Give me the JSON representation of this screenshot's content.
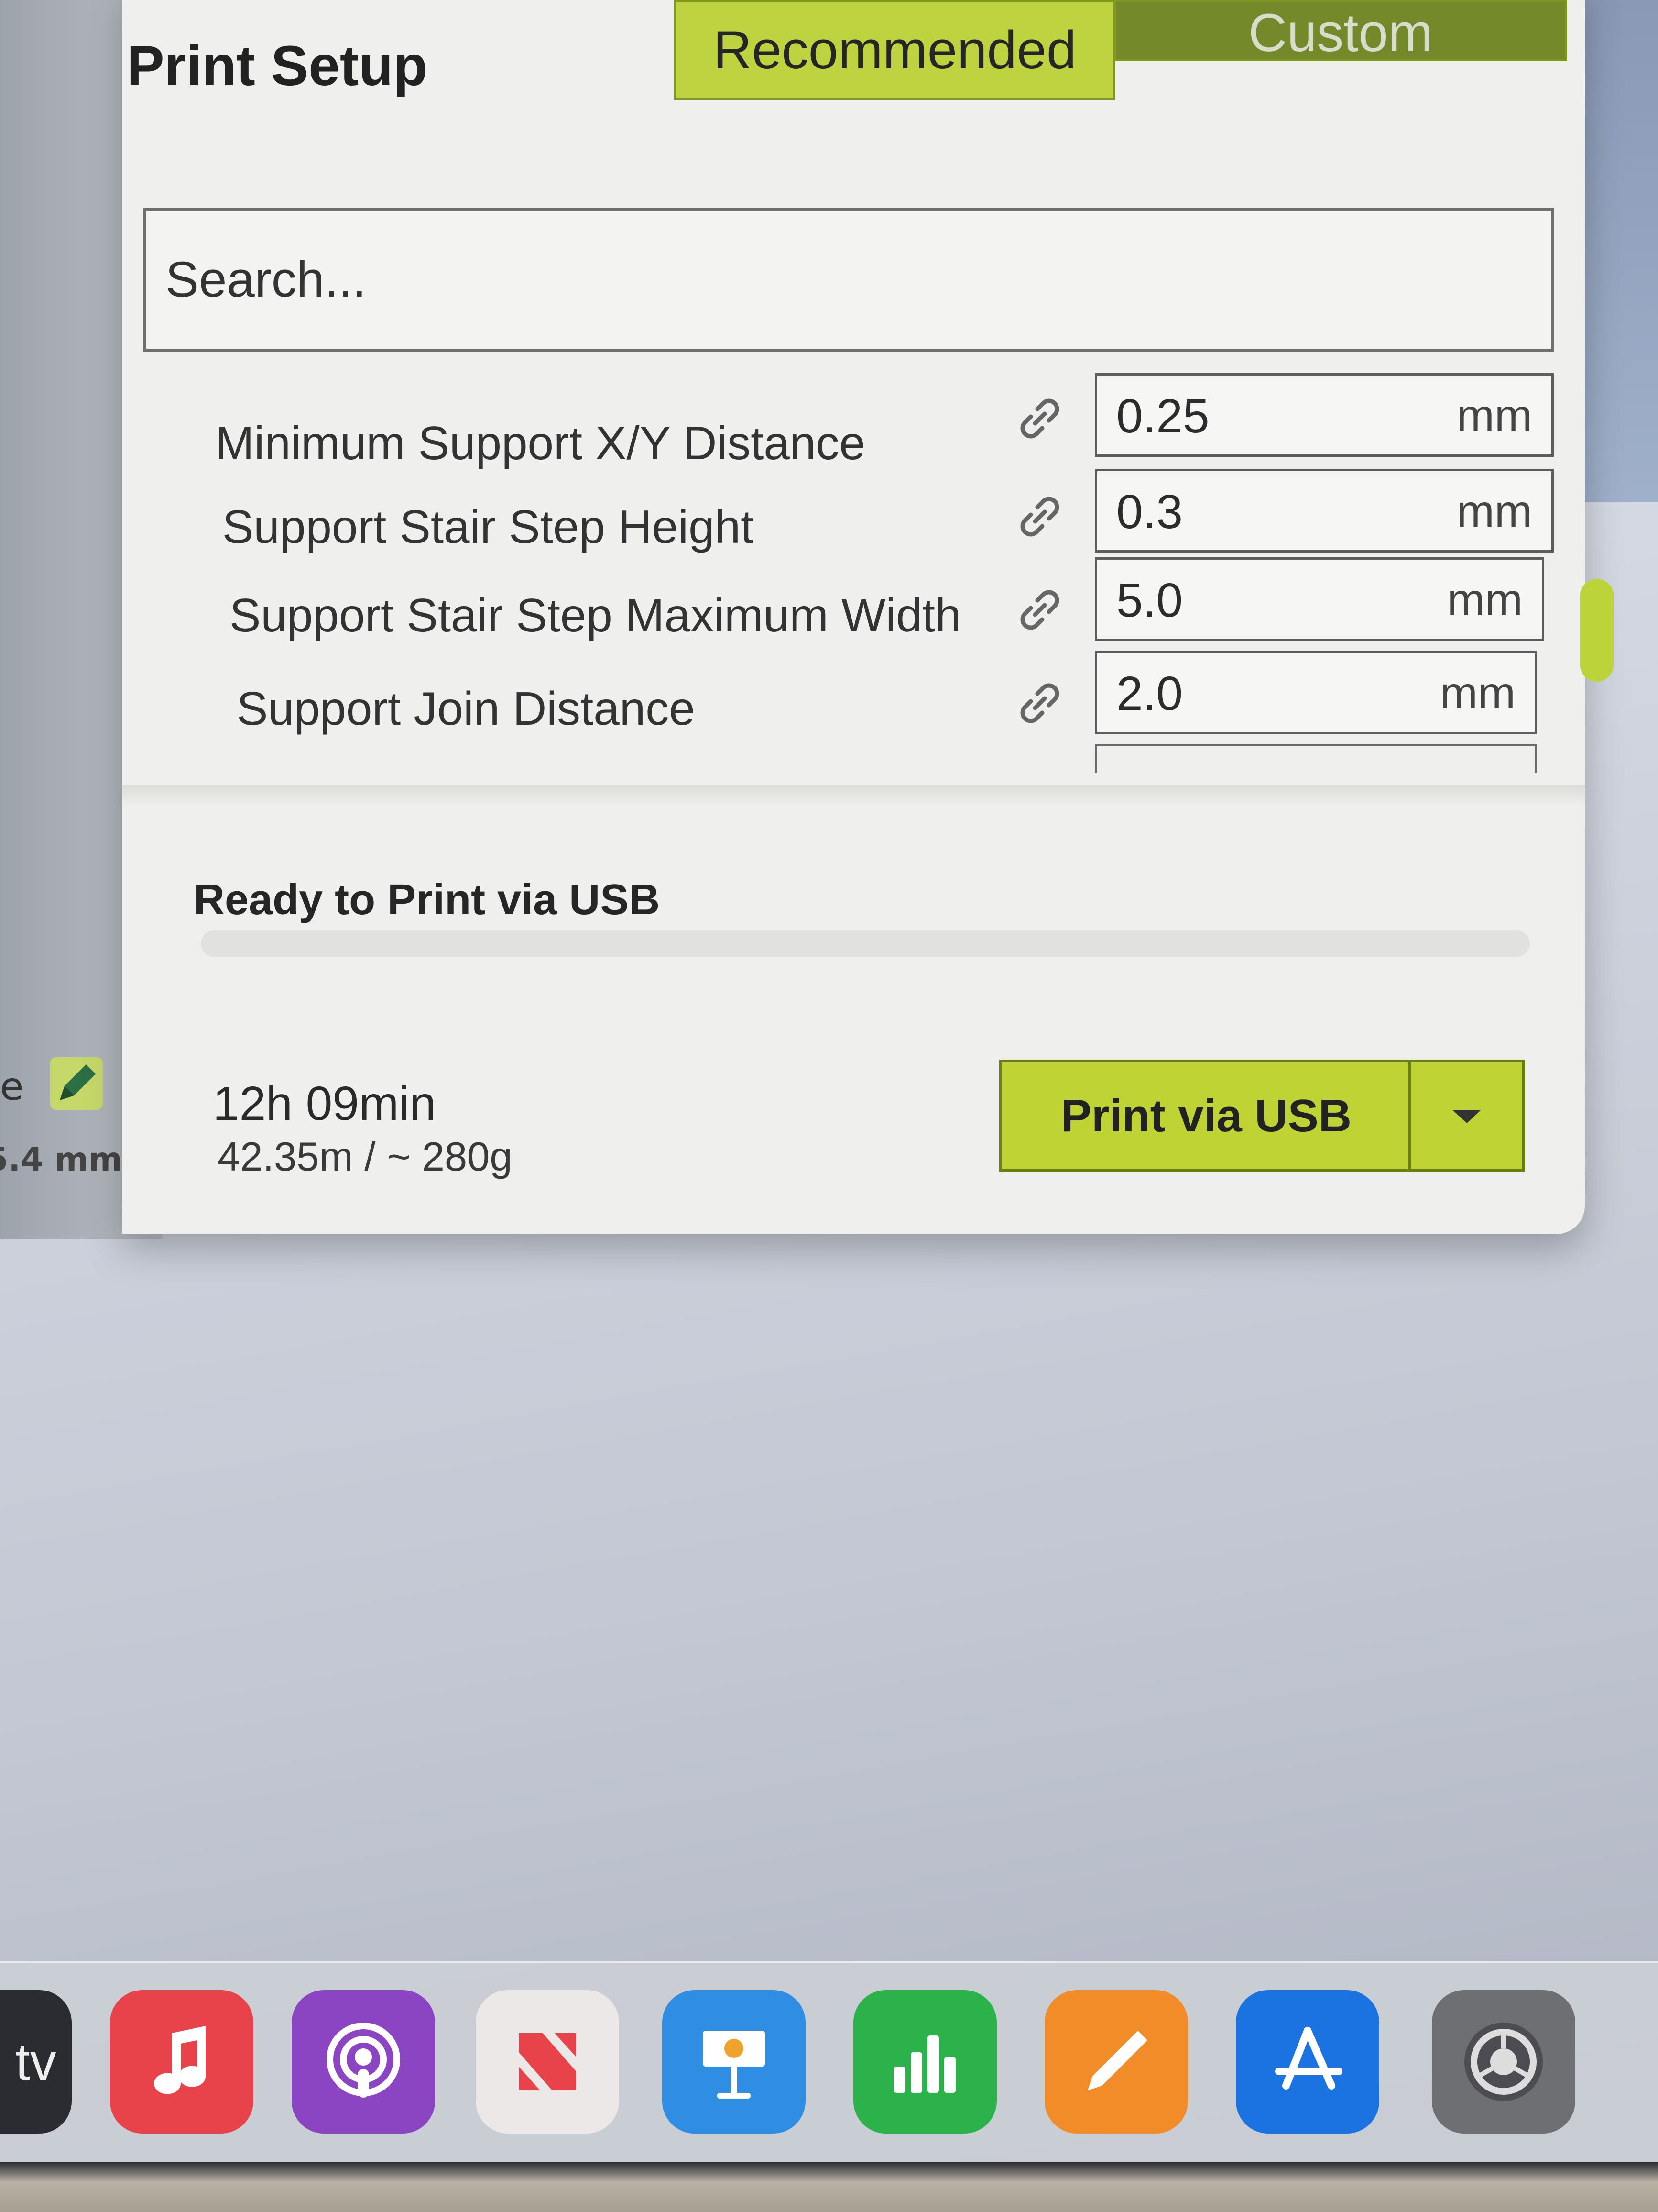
{
  "background_app": {
    "edit_label": "e",
    "dimension_label": "5.4 mm"
  },
  "panel": {
    "title": "Print Setup",
    "tabs": [
      {
        "label": "Recommended",
        "active": true
      },
      {
        "label": "Custom",
        "active": false
      }
    ],
    "search": {
      "placeholder": "Search..."
    },
    "settings": [
      {
        "label": "Minimum Support X/Y Distance",
        "value": "0.25",
        "unit": "mm"
      },
      {
        "label": "Support Stair Step Height",
        "value": "0.3",
        "unit": "mm"
      },
      {
        "label": "Support Stair Step Maximum Width",
        "value": "5.0",
        "unit": "mm"
      },
      {
        "label": "Support Join Distance",
        "value": "2.0",
        "unit": "mm"
      }
    ],
    "status": "Ready to Print via USB",
    "estimate": {
      "time": "12h 09min",
      "material": "42.35m / ~ 280g"
    },
    "print_button_label": "Print via USB"
  },
  "dock": {
    "items": [
      {
        "name": "tv",
        "label": "tv"
      },
      {
        "name": "music"
      },
      {
        "name": "podcasts"
      },
      {
        "name": "news"
      },
      {
        "name": "keynote"
      },
      {
        "name": "numbers"
      },
      {
        "name": "pages"
      },
      {
        "name": "app-store"
      },
      {
        "name": "system-preferences"
      }
    ]
  },
  "colors": {
    "accent_green": "#bfd334",
    "dark_green": "#73892a",
    "panel_bg": "#efefed"
  }
}
